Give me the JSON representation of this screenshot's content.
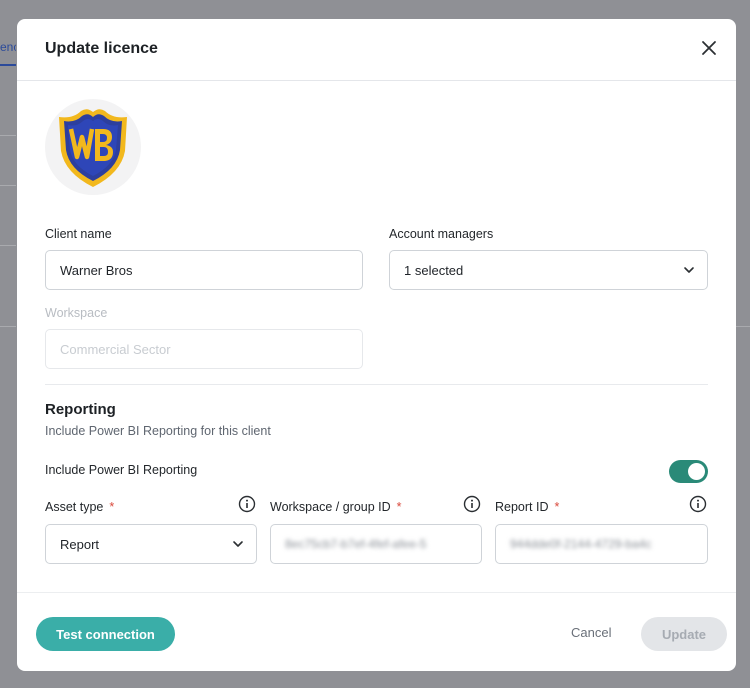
{
  "background": {
    "tab_fragment": "enc"
  },
  "modal": {
    "title": "Update licence",
    "logo_icon": "warner-bros-shield-logo",
    "client_name": {
      "label": "Client name",
      "value": "Warner Bros"
    },
    "account_managers": {
      "label": "Account managers",
      "value": "1 selected"
    },
    "workspace": {
      "label": "Workspace",
      "placeholder": "Commercial Sector"
    },
    "reporting": {
      "title": "Reporting",
      "subtitle": "Include Power BI Reporting for this client",
      "toggle_label": "Include Power BI Reporting",
      "toggle_on": true,
      "asset_type": {
        "label": "Asset type",
        "value": "Report"
      },
      "workspace_group_id": {
        "label": "Workspace / group ID",
        "value": "8ec75cb7-b7ef-4fef-afee-5"
      },
      "report_id": {
        "label": "Report ID",
        "value": "944dde0f-2144-4729-ba4c"
      },
      "required_marker": "*"
    },
    "footer": {
      "test_connection": "Test connection",
      "cancel": "Cancel",
      "update": "Update"
    }
  },
  "colors": {
    "accent_teal": "#3aaea8",
    "toggle_on": "#2a8a78",
    "required": "#d9483b"
  }
}
